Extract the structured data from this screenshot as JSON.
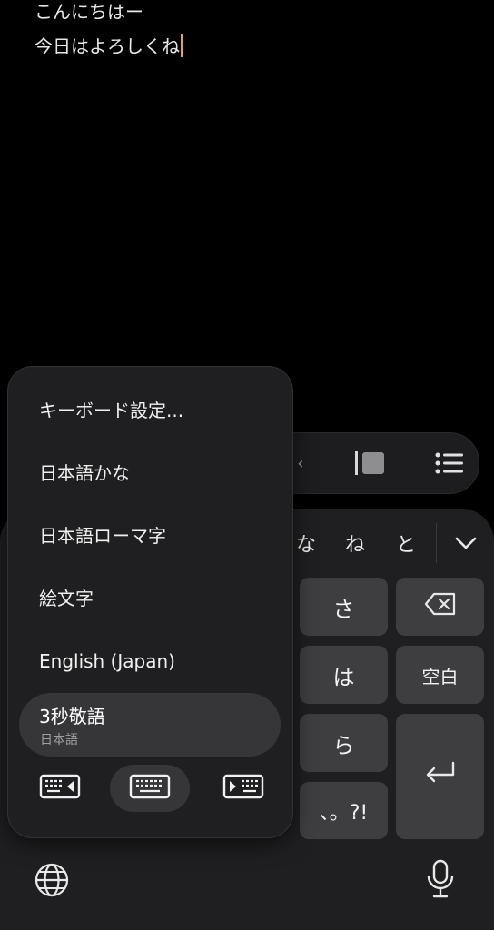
{
  "editor": {
    "lines": [
      "こんにちはー",
      "今日はよろしくね"
    ]
  },
  "keyboard": {
    "candidates": [
      "な",
      "ね",
      "と"
    ],
    "keys": {
      "sa": "さ",
      "ha": "は",
      "ra": "ら",
      "punct": "、。?!",
      "space": "空白"
    }
  },
  "menu": {
    "settings": "キーボード設定...",
    "kana": "日本語かな",
    "romaji": "日本語ローマ字",
    "emoji": "絵文字",
    "english": "English (Japan)",
    "selected_title": "3秒敬語",
    "selected_subtitle": "日本語"
  },
  "icons": {
    "toolbar": [
      "text-style-icon",
      "list-icon"
    ],
    "modes": [
      "keyboard-left-icon",
      "keyboard-center-icon",
      "keyboard-right-icon"
    ],
    "bottom": [
      "globe-icon",
      "microphone-icon"
    ],
    "backspace": "backspace-icon",
    "enter": "return-icon"
  },
  "colors": {
    "caret": "#e0a93c",
    "key": "#3e3e41",
    "panel": "#1f1f21"
  }
}
